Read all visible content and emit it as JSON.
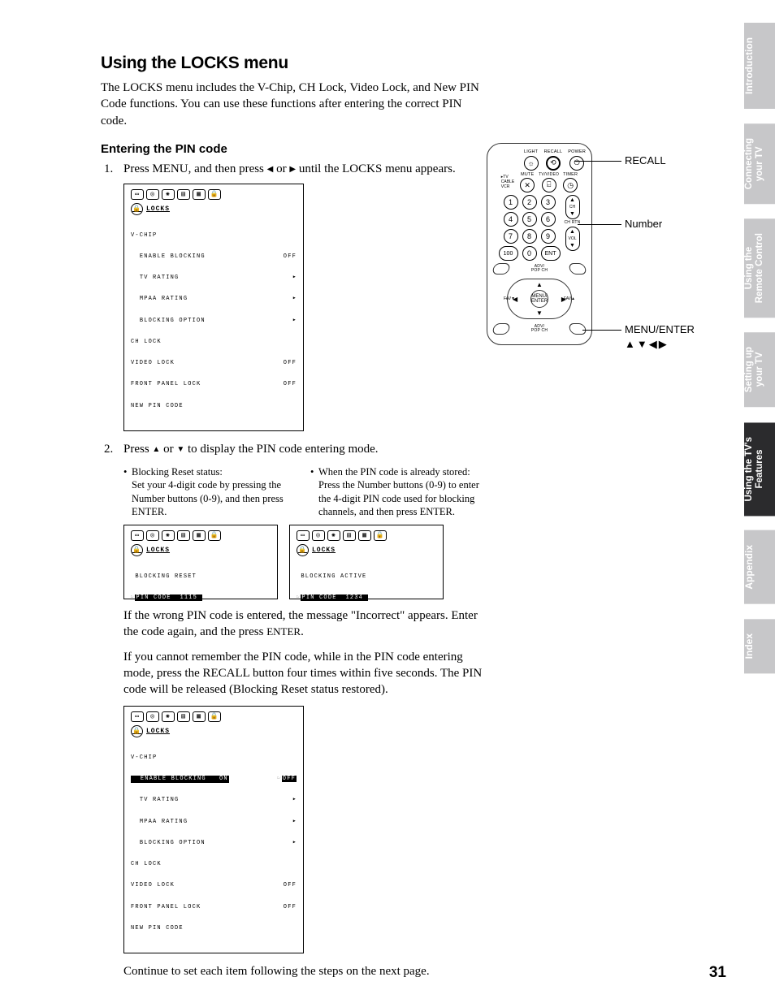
{
  "heading": "Using the LOCKS menu",
  "intro": "The LOCKS menu includes the V-Chip, CH Lock, Video Lock, and New PIN Code functions. You can use these functions after entering the correct PIN code.",
  "subheading": "Entering the PIN code",
  "step1_a": "Press MENU, and then press ",
  "step1_b": " or ",
  "step1_c": " until the LOCKS menu appears.",
  "step2_a": "Press ",
  "step2_b": " or ",
  "step2_c": " to display the PIN code entering mode.",
  "bullet1_title": "Blocking Reset status:",
  "bullet1_body": "Set your 4-digit code by pressing the Number buttons (0-9), and then press ENTER.",
  "bullet2_title": "When the PIN code is already stored:",
  "bullet2_body": "Press the Number buttons (0-9) to enter the 4-digit PIN code used for blocking channels, and then press ENTER.",
  "para1_a": "If the wrong PIN code is entered, the message \"Incorrect\" appears. Enter the code again, and the press ",
  "para1_enter": "ENTER",
  "para1_b": ".",
  "para2": "If you cannot remember the PIN code, while in the PIN code entering mode, press the RECALL button four times within five seconds. The PIN code will be released (Blocking Reset status restored).",
  "para3": "Continue to set each item following the steps on the next page.",
  "osd": {
    "title": "LOCKS",
    "menu1": {
      "l1": "V-CHIP",
      "l2": "ENABLE BLOCKING",
      "l2v": "OFF",
      "l3": "TV RATING",
      "l4": "MPAA RATING",
      "l5": "BLOCKING OPTION",
      "l6": "CH LOCK",
      "l7": "VIDEO LOCK",
      "l7v": "OFF",
      "l8": "FRONT PANEL LOCK",
      "l8v": "OFF",
      "l9": "NEW PIN CODE"
    },
    "reset": {
      "l1": "BLOCKING RESET",
      "l2a": "PIN CODE",
      "l2b": "1115"
    },
    "active": {
      "l1": "BLOCKING ACTIVE",
      "l2a": "PIN CODE",
      "l2b": "1234"
    },
    "menu2": {
      "on": "ON",
      "off": "OFF"
    }
  },
  "remote": {
    "top_labels": [
      "LIGHT",
      "RECALL",
      "POWER"
    ],
    "switch": [
      "TV",
      "CABLE",
      "VCR"
    ],
    "row2_labels": [
      "MUTE",
      "TV/VIDEO",
      "TIMER"
    ],
    "numbers": [
      "1",
      "2",
      "3",
      "4",
      "5",
      "6",
      "7",
      "8",
      "9",
      "100",
      "0",
      "ENT"
    ],
    "ch": "CH",
    "chrtn": "CH RTN",
    "vol": "VOL",
    "adv_top": "ADV/\nPOP CH",
    "adv_bot": "ADV/\nPOP CH",
    "menu": "MENU/\nENTER",
    "fav_l": "FAV▼",
    "fav_r": "FAV▲"
  },
  "callouts": {
    "recall": "RECALL",
    "number": "Number",
    "menu": "MENU/ENTER",
    "arrows": "▲▼◀▶"
  },
  "tabs": [
    "Introduction",
    "Connecting\nyour TV",
    "Using the\nRemote Control",
    "Setting up\nyour TV",
    "Using the TV's\nFeatures",
    "Appendix",
    "Index"
  ],
  "active_tab_index": 4,
  "page_number": "31"
}
